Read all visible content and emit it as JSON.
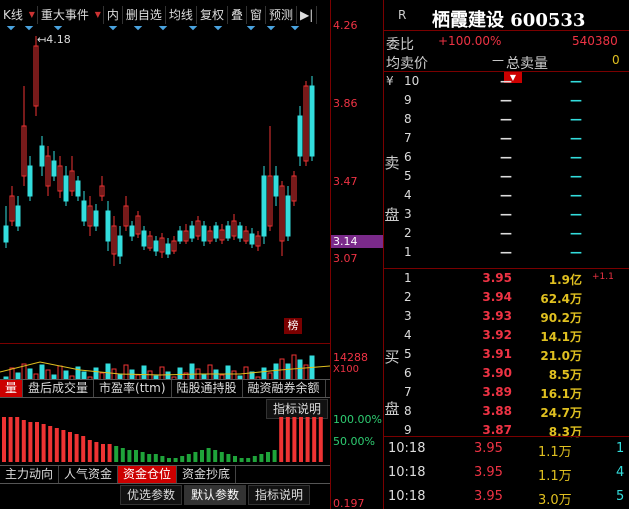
{
  "toolbar": {
    "items": [
      "K线",
      "重大事件",
      "内",
      "删自选",
      "均线",
      "复权",
      "叠",
      "窗",
      "预测"
    ]
  },
  "price_axis": {
    "labels": [
      "4.26",
      "3.86",
      "3.47",
      "3.14",
      "3.07"
    ],
    "current": "3.14",
    "high_marker": "4.18",
    "vol_labels": [
      "14288",
      "X100"
    ]
  },
  "badge": "榜",
  "indicator_tabs": [
    "量",
    "盘后成交量",
    "市盈率(ttm)",
    "陆股通持股",
    "融资融券余额"
  ],
  "indicator_button": "指标说明",
  "pct_labels": [
    "100.00%",
    "50.00%"
  ],
  "bottom_tabs": [
    "主力动向",
    "人气资金",
    "资金仓位",
    "资金抄底"
  ],
  "bottom_buttons": [
    "优选参数",
    "默认参数",
    "指标说明"
  ],
  "bottom_value": "0.197",
  "quote": {
    "r_label": "R",
    "name": "栖霞建设 600533",
    "wei_bi_label": "委比",
    "wei_bi_value": "+100.00%",
    "wei_cha": "540380",
    "jun_mai_label": "均卖价",
    "jun_mai_value": "—",
    "zong_mai_label": "总卖量",
    "zong_mai_value": "0",
    "yen": "¥",
    "sell_label": "卖盘",
    "buy_label": "买盘",
    "dash": "—",
    "sell_levels": [
      "10",
      "9",
      "8",
      "7",
      "6",
      "5",
      "4",
      "3",
      "2",
      "1"
    ],
    "buy_levels": [
      {
        "level": "1",
        "price": "3.95",
        "volume": "1.9亿",
        "extra": "+1.1"
      },
      {
        "level": "2",
        "price": "3.94",
        "volume": "62.4万",
        "extra": ""
      },
      {
        "level": "3",
        "price": "3.93",
        "volume": "90.2万",
        "extra": ""
      },
      {
        "level": "4",
        "price": "3.92",
        "volume": "14.1万",
        "extra": ""
      },
      {
        "level": "5",
        "price": "3.91",
        "volume": "21.0万",
        "extra": ""
      },
      {
        "level": "6",
        "price": "3.90",
        "volume": "8.5万",
        "extra": ""
      },
      {
        "level": "7",
        "price": "3.89",
        "volume": "16.1万",
        "extra": ""
      },
      {
        "level": "8",
        "price": "3.88",
        "volume": "24.7万",
        "extra": ""
      },
      {
        "level": "9",
        "price": "3.87",
        "volume": "8.3万",
        "extra": ""
      }
    ],
    "ticks": [
      {
        "time": "10:18",
        "price": "3.95",
        "volume": "1.1万",
        "count": "1"
      },
      {
        "time": "10:18",
        "price": "3.95",
        "volume": "1.1万",
        "count": "4"
      },
      {
        "time": "10:18",
        "price": "3.95",
        "volume": "3.0万",
        "count": "5"
      }
    ]
  },
  "colors": {
    "up": "#e33",
    "down": "#3dd",
    "accent": "#7a0000",
    "highlight": "#7a2a8a"
  }
}
